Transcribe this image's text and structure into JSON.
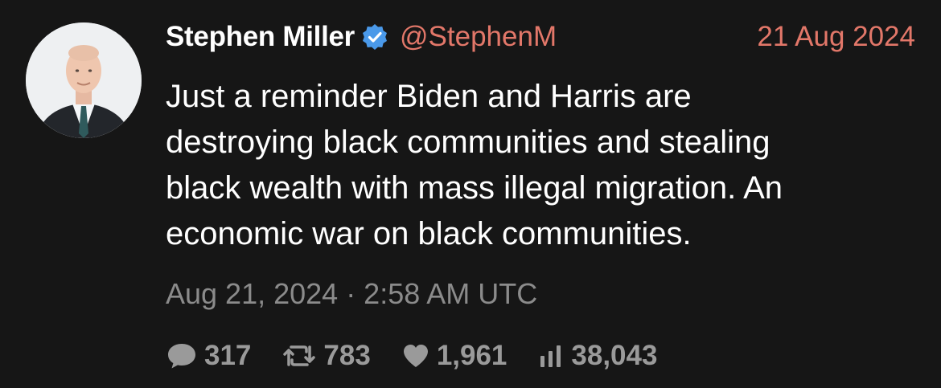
{
  "tweet": {
    "author_name": "Stephen Miller",
    "handle": "@StephenM",
    "date": "21 Aug 2024",
    "verified": true,
    "text_lines": [
      "Just a reminder Biden and Harris are",
      "destroying black communities and stealing",
      "black wealth with mass illegal migration. An",
      "economic war on black communities."
    ],
    "timestamp": "Aug 21, 2024 · 2:58 AM UTC",
    "stats": {
      "replies": "317",
      "retweets": "783",
      "likes": "1,961",
      "views": "38,043"
    },
    "icons": {
      "avatar": "profile-photo",
      "verified": "verified-badge-icon",
      "replies": "comment-icon",
      "retweets": "retweet-icon",
      "likes": "heart-icon",
      "views": "bar-chart-icon"
    }
  },
  "colors": {
    "background": "#161616",
    "text": "#ffffff",
    "accent": "#e27769",
    "muted": "#8b8b8b",
    "verified": "#4a99e9"
  }
}
